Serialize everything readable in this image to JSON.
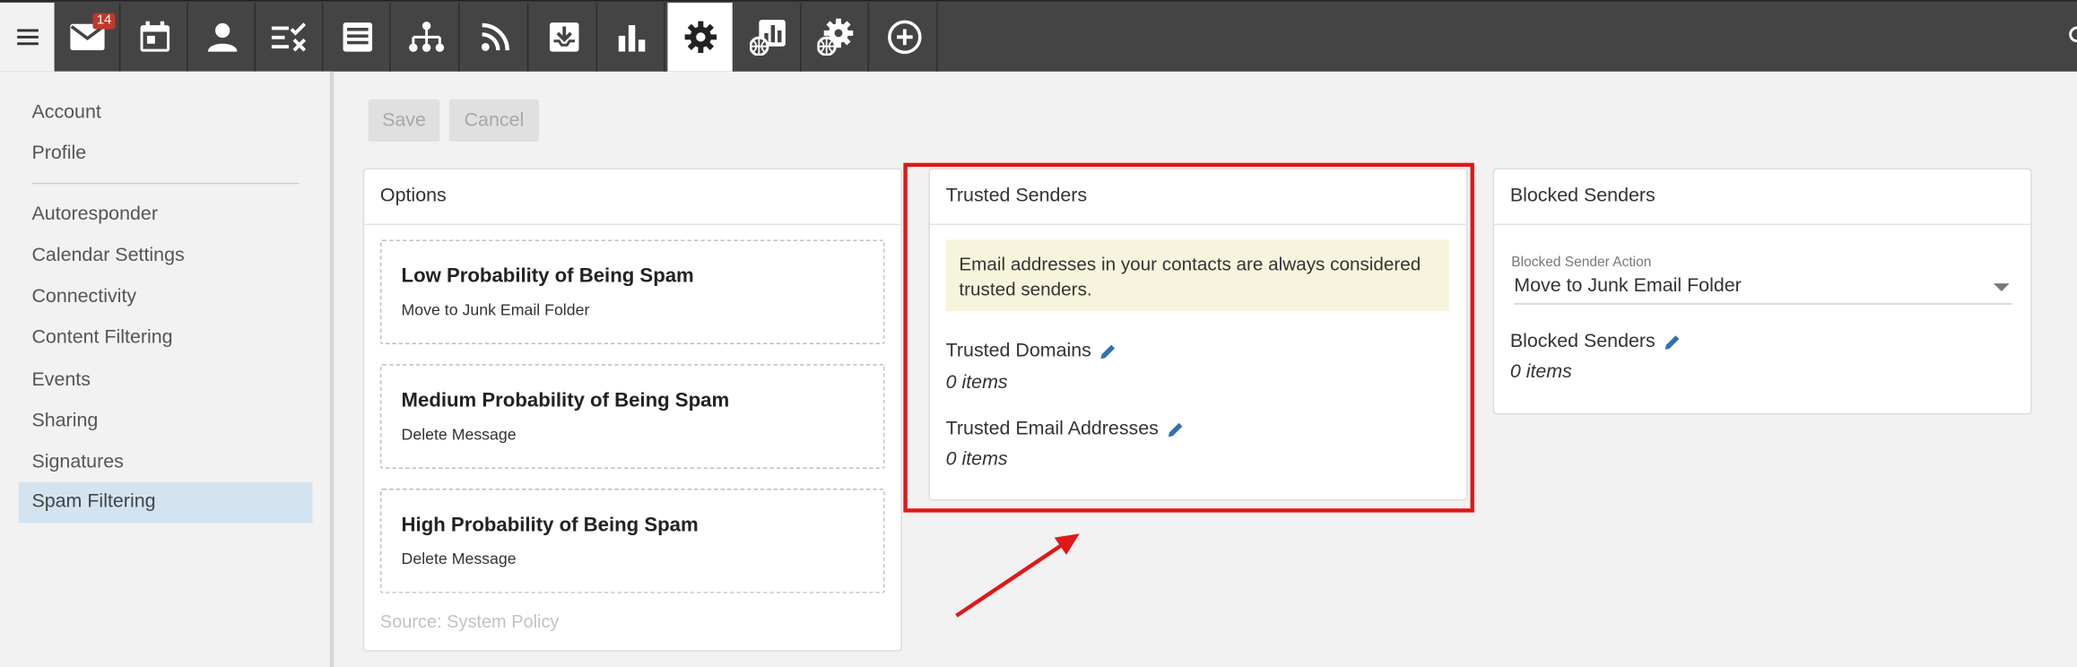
{
  "topbar": {
    "menu_icon": "hamburger-icon",
    "mail_badge": "14",
    "tools": [
      {
        "icon": "mail-icon"
      },
      {
        "icon": "calendar-icon"
      },
      {
        "icon": "contacts-icon"
      },
      {
        "icon": "tasks-icon"
      },
      {
        "icon": "notes-icon"
      },
      {
        "icon": "org-chart-icon"
      },
      {
        "icon": "rss-icon"
      },
      {
        "icon": "file-storage-icon"
      },
      {
        "icon": "reports-icon"
      },
      {
        "icon": "settings-icon",
        "active": true
      },
      {
        "icon": "domain-reports-icon"
      },
      {
        "icon": "domain-settings-icon"
      },
      {
        "icon": "add-circle-icon"
      }
    ],
    "search_icon": "search-icon"
  },
  "sidebar": {
    "items": [
      {
        "label": "Account"
      },
      {
        "label": "Profile"
      },
      {
        "label": "Autoresponder"
      },
      {
        "label": "Calendar Settings"
      },
      {
        "label": "Connectivity"
      },
      {
        "label": "Content Filtering"
      },
      {
        "label": "Events"
      },
      {
        "label": "Sharing"
      },
      {
        "label": "Signatures"
      },
      {
        "label": "Spam Filtering",
        "selected": true
      }
    ]
  },
  "actions": {
    "save_label": "Save",
    "cancel_label": "Cancel"
  },
  "options_panel": {
    "title": "Options",
    "items": [
      {
        "title": "Low Probability of Being Spam",
        "action": "Move to Junk Email Folder"
      },
      {
        "title": "Medium Probability of Being Spam",
        "action": "Delete Message"
      },
      {
        "title": "High Probability of Being Spam",
        "action": "Delete Message"
      }
    ],
    "source_note": "Source: System Policy"
  },
  "trusted_panel": {
    "title": "Trusted Senders",
    "notice": "Email addresses in your contacts are always considered trusted senders.",
    "domains_label": "Trusted Domains",
    "domains_value": "0 items",
    "emails_label": "Trusted Email Addresses",
    "emails_value": "0 items"
  },
  "blocked_panel": {
    "title": "Blocked Senders",
    "action_label": "Blocked Sender Action",
    "action_value": "Move to Junk Email Folder",
    "senders_label": "Blocked Senders",
    "senders_value": "0 items"
  },
  "colors": {
    "topbar_bg": "#444444",
    "selected_nav": "#d3e4f0",
    "notice_bg": "#f7f4dd",
    "highlight": "#e01818",
    "edit_icon": "#2f6fb3"
  }
}
